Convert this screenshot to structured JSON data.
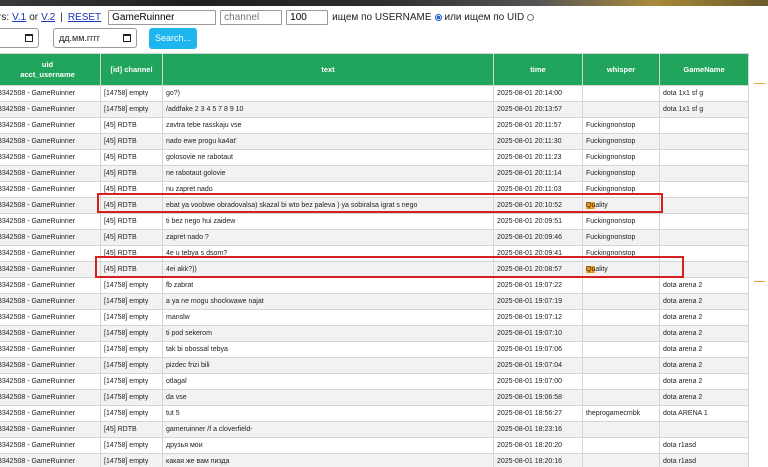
{
  "filters": {
    "prefix": "rs:",
    "link_v1": "V.1",
    "or_text": "or",
    "link_v2": "V.2",
    "separator": "|",
    "reset": "RESET",
    "username_value": "GameRuinner",
    "channel_placeholder": "channel",
    "limit_value": "100",
    "search_by_username_label": "ищем по USERNAME",
    "search_by_uid_label": "или ищем по UID",
    "date_from_value": "",
    "date_to_placeholder": "дд.мм.гггг",
    "search_button": "Search..."
  },
  "table": {
    "headers": {
      "uid_line1": "uid",
      "uid_line2": "acct_username",
      "channel": "[id] channel",
      "text": "text",
      "time": "time",
      "whisper": "whisper",
      "gamename": "GameName"
    },
    "rows": [
      {
        "uid": "3342508 - GameRuinner",
        "channel": "[14758] empty",
        "text": "go?)",
        "time": "2025-08-01 20:14:00",
        "whisper": "",
        "game": "dota 1x1 sf g"
      },
      {
        "uid": "3342508 - GameRuinner",
        "channel": "[14758] empty",
        "text": "/addfake 2 3 4 5 7 8 9 10",
        "time": "2025-08-01 20:13:57",
        "whisper": "",
        "game": "dota 1x1 sf g"
      },
      {
        "uid": "3342508 - GameRuinner",
        "channel": "[45] RDTB",
        "text": "zavtra tebe rasskaju vse",
        "time": "2025-08-01 20:11:57",
        "whisper": "Fuckingnonstop",
        "game": ""
      },
      {
        "uid": "3342508 - GameRuinner",
        "channel": "[45] RDTB",
        "text": "nado ewe progu ka4at'",
        "time": "2025-08-01 20:11:30",
        "whisper": "Fuckingnonstop",
        "game": ""
      },
      {
        "uid": "3342508 - GameRuinner",
        "channel": "[45] RDTB",
        "text": "golosovie ne rabotaut",
        "time": "2025-08-01 20:11:23",
        "whisper": "Fuckingnonstop",
        "game": ""
      },
      {
        "uid": "3342508 - GameRuinner",
        "channel": "[45] RDTB",
        "text": "ne rabotaut golovie",
        "time": "2025-08-01 20:11:14",
        "whisper": "Fuckingnonstop",
        "game": ""
      },
      {
        "uid": "3342508 - GameRuinner",
        "channel": "[45] RDTB",
        "text": "nu zapret nado",
        "time": "2025-08-01 20:11:03",
        "whisper": "Fuckingnonstop",
        "game": ""
      },
      {
        "uid": "3342508 - GameRuinner",
        "channel": "[45] RDTB",
        "text": "ebat ya voobwe obradovalsa) skazal bi wto bez paleva ) ya sobiralsa igrat s nego",
        "time": "2025-08-01 20:10:52",
        "whisper": "Quality",
        "game": ""
      },
      {
        "uid": "3342508 - GameRuinner",
        "channel": "[45] RDTB",
        "text": "ti bez nego hui zaidew",
        "time": "2025-08-01 20:09:51",
        "whisper": "Fuckingnonstop",
        "game": ""
      },
      {
        "uid": "3342508 - GameRuinner",
        "channel": "[45] RDTB",
        "text": "zapret nado ?",
        "time": "2025-08-01 20:09:46",
        "whisper": "Fuckingnonstop",
        "game": ""
      },
      {
        "uid": "3342508 - GameRuinner",
        "channel": "[45] RDTB",
        "text": "4e u tebya s dsom?",
        "time": "2025-08-01 20:09:41",
        "whisper": "Fuckingnonstop",
        "game": ""
      },
      {
        "uid": "3342508 - GameRuinner",
        "channel": "[45] RDTB",
        "text": "4ei akk?))",
        "time": "2025-08-01 20:08:57",
        "whisper": "Quality",
        "game": ""
      },
      {
        "uid": "3342508 - GameRuinner",
        "channel": "[14758] empty",
        "text": "fb zabrat",
        "time": "2025-08-01 19:07:22",
        "whisper": "",
        "game": "dota arena 2"
      },
      {
        "uid": "3342508 - GameRuinner",
        "channel": "[14758] empty",
        "text": "a ya ne mogu shockwawe najat",
        "time": "2025-08-01 19:07:19",
        "whisper": "",
        "game": "dota arena 2"
      },
      {
        "uid": "3342508 - GameRuinner",
        "channel": "[14758] empty",
        "text": "manslw",
        "time": "2025-08-01 19:07:12",
        "whisper": "",
        "game": "dota arena 2"
      },
      {
        "uid": "3342508 - GameRuinner",
        "channel": "[14758] empty",
        "text": "ti pod sekerom",
        "time": "2025-08-01 19:07:10",
        "whisper": "",
        "game": "dota arena 2"
      },
      {
        "uid": "3342508 - GameRuinner",
        "channel": "[14758] empty",
        "text": "tak bi obossal tebya",
        "time": "2025-08-01 19:07:06",
        "whisper": "",
        "game": "dota arena 2"
      },
      {
        "uid": "3342508 - GameRuinner",
        "channel": "[14758] empty",
        "text": "pizdec frizi bili",
        "time": "2025-08-01 19:07:04",
        "whisper": "",
        "game": "dota arena 2"
      },
      {
        "uid": "3342508 - GameRuinner",
        "channel": "[14758] empty",
        "text": "otlagal",
        "time": "2025-08-01 19:07:00",
        "whisper": "",
        "game": "dota arena 2"
      },
      {
        "uid": "3342508 - GameRuinner",
        "channel": "[14758] empty",
        "text": "da vse",
        "time": "2025-08-01 19:06:58",
        "whisper": "",
        "game": "dota arena 2"
      },
      {
        "uid": "3342508 - GameRuinner",
        "channel": "[14758] empty",
        "text": "tut 5",
        "time": "2025-08-01 18:56:27",
        "whisper": "theprogamecmbk",
        "game": "dota ARENA 1"
      },
      {
        "uid": "3342508 - GameRuinner",
        "channel": "[45] RDTB",
        "text": "gameruinner /f a cloverfield-",
        "time": "2025-08-01 18:23:16",
        "whisper": "",
        "game": ""
      },
      {
        "uid": "3342508 - GameRuinner",
        "channel": "[14758] empty",
        "text": "друзья мои",
        "time": "2025-08-01 18:20:20",
        "whisper": "",
        "game": "dota r1asd"
      },
      {
        "uid": "3342508 - GameRuinner",
        "channel": "[14758] empty",
        "text": "какая же вам пизда",
        "time": "2025-08-01 18:20:16",
        "whisper": "",
        "game": "dota r1asd"
      }
    ]
  },
  "colors": {
    "header_bg": "#21a45b",
    "highlight_box": "#d62020",
    "search_button": "#1fb6f0",
    "whisper_mark": "#f0a020",
    "link": "#1a35b8"
  }
}
